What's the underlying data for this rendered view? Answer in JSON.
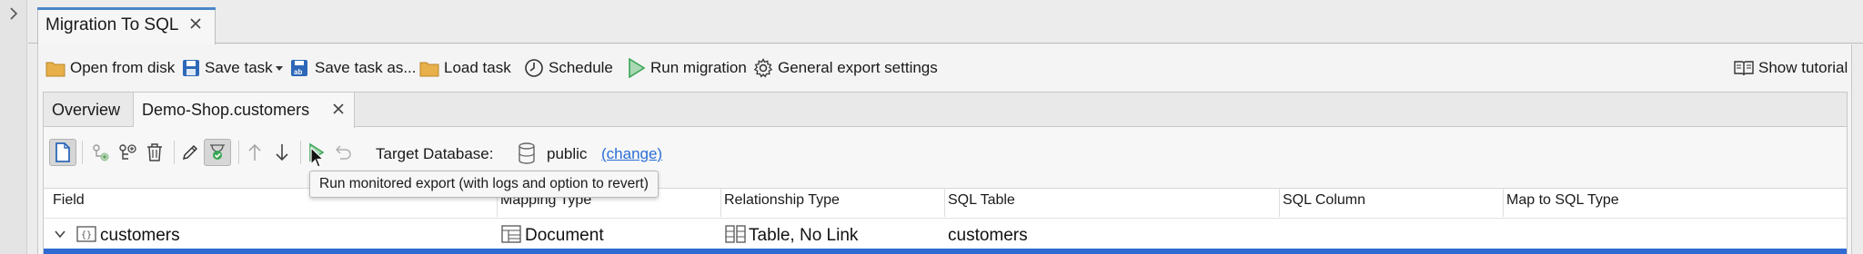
{
  "document_tab": {
    "title": "Migration To SQL"
  },
  "toolbar": {
    "open_from_disk": "Open from disk",
    "save_task": "Save task",
    "save_task_as": "Save task as...",
    "load_task": "Load task",
    "schedule": "Schedule",
    "run_migration": "Run migration",
    "general_export_settings": "General export settings",
    "show_tutorial": "Show tutorial"
  },
  "inner_tabs": [
    {
      "label": "Overview"
    },
    {
      "label": "Demo-Shop.customers",
      "active": true
    }
  ],
  "target": {
    "label": "Target Database:",
    "database": "public",
    "change_link": "(change)"
  },
  "tooltip": {
    "text": "Run monitored export (with logs and option to revert)"
  },
  "table": {
    "columns": [
      "Field",
      "Mapping Type",
      "Relationship Type",
      "SQL Table",
      "SQL Column",
      "Map to SQL Type"
    ],
    "rows": [
      {
        "field": "customers",
        "mapping_type": "Document",
        "relationship_type": "Table, No Link",
        "sql_table": "customers",
        "sql_column": "",
        "map_to_sql_type": ""
      }
    ]
  },
  "colors": {
    "accent": "#4a86c8",
    "link": "#2a6fd6",
    "selection": "#2f6ad2",
    "run_green": "#3aa655",
    "folder": "#e8b04a",
    "floppy": "#2d68b8"
  },
  "icons": [
    "chevron-right-icon",
    "close-icon",
    "folder-icon",
    "floppy-icon",
    "caret-down-icon",
    "floppy-as-icon",
    "clock-icon",
    "play-icon",
    "gear-icon",
    "book-icon",
    "new-document-icon",
    "add-node-icon",
    "add-branch-icon",
    "trash-icon",
    "pencil-icon",
    "validate-icon",
    "arrow-up-icon",
    "arrow-down-icon",
    "run-monitored-icon",
    "revert-icon",
    "database-icon",
    "chevron-down-icon",
    "object-icon",
    "document-icon",
    "table-link-icon"
  ]
}
